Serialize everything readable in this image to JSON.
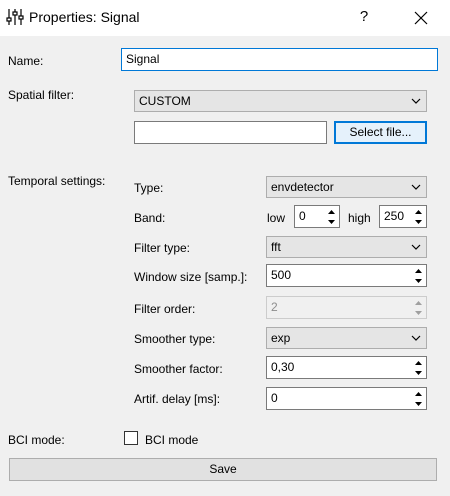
{
  "window": {
    "title": "Properties: Signal",
    "help_icon": "help-icon",
    "close_icon": "close-icon",
    "title_icon": "sliders-icon"
  },
  "name": {
    "label": "Name:",
    "value": "Signal"
  },
  "spatial": {
    "label": "Spatial filter:",
    "combo_value": "CUSTOM",
    "file_value": "",
    "select_button": "Select file..."
  },
  "temporal": {
    "label": "Temporal settings:",
    "type_label": "Type:",
    "type_value": "envdetector",
    "band_label": "Band:",
    "low_label": "low",
    "low_value": "0",
    "high_label": "high",
    "high_value": "250",
    "filter_type_label": "Filter type:",
    "filter_type_value": "fft",
    "window_size_label": "Window size [samp.]:",
    "window_size_value": "500",
    "filter_order_label": "Filter order:",
    "filter_order_value": "2",
    "smoother_type_label": "Smoother type:",
    "smoother_type_value": "exp",
    "smoother_factor_label": "Smoother factor:",
    "smoother_factor_value": "0,30",
    "artif_delay_label": "Artif. delay [ms]:",
    "artif_delay_value": "0"
  },
  "bci": {
    "label": "BCI mode:",
    "checkbox_label": "BCI mode",
    "checked": false
  },
  "save_button": "Save",
  "colors": {
    "focus": "#0078d7",
    "background": "#f0f0f0",
    "title_bar": "#ffffff"
  }
}
